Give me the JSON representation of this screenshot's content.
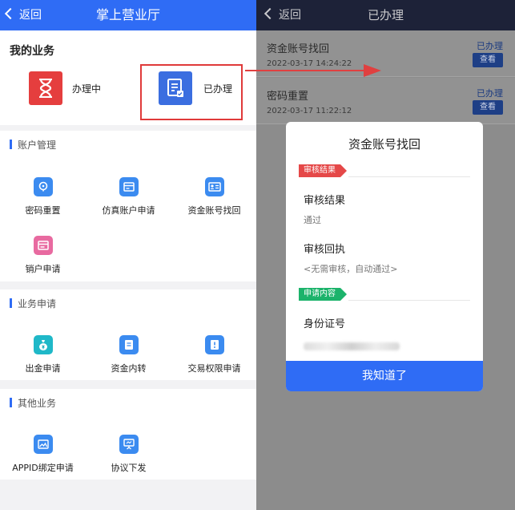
{
  "left": {
    "nav": {
      "back": "返回",
      "title": "掌上营业厅"
    },
    "my_business": {
      "label": "我的业务",
      "items": [
        {
          "label": "办理中",
          "icon": "hourglass-icon",
          "color": "#e53e3e"
        },
        {
          "label": "已办理",
          "icon": "document-check-icon",
          "color": "#3b6ee0"
        }
      ]
    },
    "sections": [
      {
        "title": "账户管理",
        "items": [
          {
            "label": "密码重置",
            "icon": "lock-icon",
            "color": "#3b8bf0"
          },
          {
            "label": "仿真账户申请",
            "icon": "card-icon",
            "color": "#3b8bf0"
          },
          {
            "label": "资金账号找回",
            "icon": "id-card-icon",
            "color": "#3b8bf0"
          },
          {
            "label": "销户申请",
            "icon": "account-icon",
            "color": "#e86aa0"
          }
        ]
      },
      {
        "title": "业务申请",
        "items": [
          {
            "label": "出金申请",
            "icon": "money-bag-icon",
            "color": "#1fb8c8"
          },
          {
            "label": "资金内转",
            "icon": "transfer-icon",
            "color": "#3b8bf0"
          },
          {
            "label": "交易权限申请",
            "icon": "permission-icon",
            "color": "#3b8bf0"
          }
        ]
      },
      {
        "title": "其他业务",
        "items": [
          {
            "label": "APPID绑定申请",
            "icon": "image-icon",
            "color": "#3b8bf0"
          },
          {
            "label": "协议下发",
            "icon": "presentation-icon",
            "color": "#3b8bf0"
          }
        ]
      }
    ]
  },
  "right": {
    "nav": {
      "back": "返回",
      "title": "已办理"
    },
    "rows": [
      {
        "title": "资金账号找回",
        "date": "2022-03-17 14:24:22",
        "status": "已办理",
        "action": "查看"
      },
      {
        "title": "密码重置",
        "date": "2022-03-17 11:22:12",
        "status": "已办理",
        "action": "查看"
      }
    ],
    "modal": {
      "title": "资金账号找回",
      "tag_review": "审核结果",
      "review_result_label": "审核结果",
      "review_result_value": "通过",
      "receipt_label": "审核回执",
      "receipt_value": "<无需审核，自动通过>",
      "tag_content": "申请内容",
      "id_label": "身份证号",
      "ok": "我知道了"
    }
  },
  "colors": {
    "primary": "#2f6cf5",
    "highlight": "#e03a3a",
    "tag_red": "#e54848",
    "tag_green": "#1cb36b"
  }
}
